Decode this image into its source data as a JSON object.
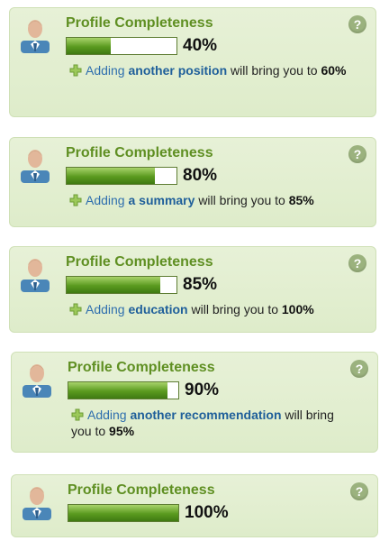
{
  "widgets": [
    {
      "title": "Profile Completeness",
      "percent_label": "40%",
      "percent": 40,
      "hint": {
        "prefix": "Adding",
        "link": "another position",
        "suffix": "will bring you to",
        "target": "60%"
      }
    },
    {
      "title": "Profile Completeness",
      "percent_label": "80%",
      "percent": 80,
      "hint": {
        "prefix": "Adding",
        "link": "a summary",
        "suffix": "will bring you to",
        "target": "85%"
      }
    },
    {
      "title": "Profile Completeness",
      "percent_label": "85%",
      "percent": 85,
      "hint": {
        "prefix": "Adding",
        "link": "education",
        "suffix": "will bring you to",
        "target": "100%"
      }
    },
    {
      "title": "Profile Completeness",
      "percent_label": "90%",
      "percent": 90,
      "hint": {
        "prefix": "Adding",
        "link": "another recommendation",
        "suffix": "will bring you to",
        "target": "95%"
      }
    },
    {
      "title": "Profile Completeness",
      "percent_label": "100%",
      "percent": 100,
      "hint": null
    }
  ],
  "icons": {
    "avatar": "user-avatar-icon",
    "help": "help-icon",
    "add": "plus-icon"
  },
  "colors": {
    "title": "#5f8f22",
    "link": "#1f5f9a",
    "card_bg": "#e3efd1",
    "bar_fill": "#5a9a1f"
  }
}
